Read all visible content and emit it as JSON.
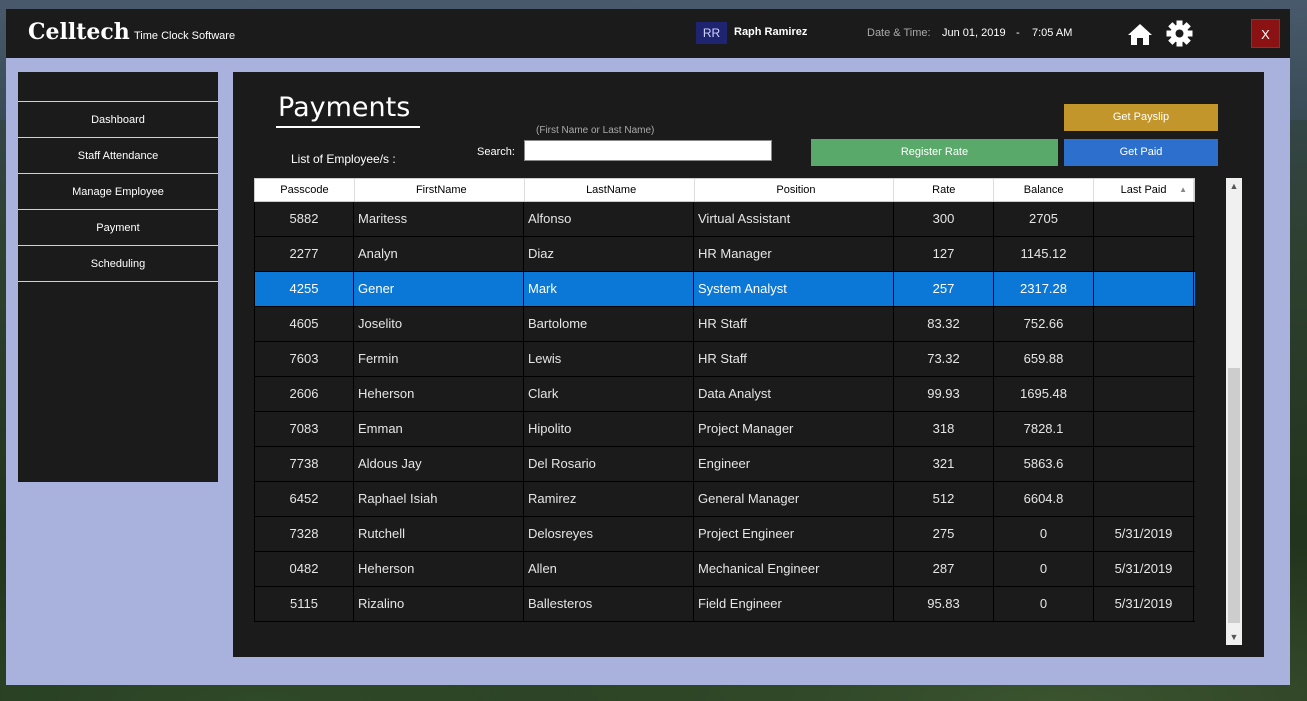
{
  "app": {
    "brand": "Celltech",
    "subtitle": "Time Clock Software",
    "user_initials": "RR",
    "user_name": "Raph Ramirez",
    "datetime_label": "Date & Time:",
    "date": "Jun 01, 2019",
    "datetime_sep": "-",
    "time": "7:05 AM",
    "close_label": "X"
  },
  "sidebar": {
    "items": [
      {
        "label": "Dashboard"
      },
      {
        "label": "Staff Attendance"
      },
      {
        "label": "Manage Employee"
      },
      {
        "label": "Payment"
      },
      {
        "label": "Scheduling"
      }
    ]
  },
  "main": {
    "title": "Payments",
    "list_label": "List of Employee/s :",
    "search_hint": "(First Name or Last Name)",
    "search_label": "Search:",
    "search_value": "",
    "buttons": {
      "payslip": "Get Payslip",
      "register": "Register Rate",
      "paid": "Get Paid"
    }
  },
  "table": {
    "columns": [
      "Passcode",
      "FirstName",
      "LastName",
      "Position",
      "Rate",
      "Balance",
      "Last Paid"
    ],
    "rows": [
      [
        "5882",
        "Maritess",
        "Alfonso",
        "Virtual Assistant",
        "300",
        "2705",
        ""
      ],
      [
        "2277",
        "Analyn",
        "Diaz",
        "HR Manager",
        "127",
        "1145.12",
        ""
      ],
      [
        "4255",
        "Gener",
        "Mark",
        "System Analyst",
        "257",
        "2317.28",
        ""
      ],
      [
        "4605",
        "Joselito",
        "Bartolome",
        "HR Staff",
        "83.32",
        "752.66",
        ""
      ],
      [
        "7603",
        "Fermin",
        "Lewis",
        "HR Staff",
        "73.32",
        "659.88",
        ""
      ],
      [
        "2606",
        "Heherson",
        "Clark",
        "Data Analyst",
        "99.93",
        "1695.48",
        ""
      ],
      [
        "7083",
        "Emman",
        "Hipolito",
        "Project Manager",
        "318",
        "7828.1",
        ""
      ],
      [
        "7738",
        "Aldous Jay",
        "Del Rosario",
        "Engineer",
        "321",
        "5863.6",
        ""
      ],
      [
        "6452",
        "Raphael Isiah",
        "Ramirez",
        "General Manager",
        "512",
        "6604.8",
        ""
      ],
      [
        "7328",
        "Rutchell",
        "Delosreyes",
        "Project Engineer",
        "275",
        "0",
        "5/31/2019"
      ],
      [
        "0482",
        "Heherson",
        "Allen",
        "Mechanical Engineer",
        "287",
        "0",
        "5/31/2019"
      ],
      [
        "5115",
        "Rizalino",
        "Ballesteros",
        "Field Engineer",
        "95.83",
        "0",
        "5/31/2019"
      ]
    ],
    "selected_index": 2
  },
  "colors": {
    "titlebar": "#1b1b1b",
    "app_bg": "#a9b2dd",
    "selected_row": "#0b78d7",
    "payslip": "#c2962a",
    "register": "#59a96a",
    "paid": "#2d6fcc",
    "close": "#8b1212"
  },
  "icons": {
    "home": "home-icon",
    "settings": "gear-icon",
    "sort": "sort-ascending-icon"
  }
}
